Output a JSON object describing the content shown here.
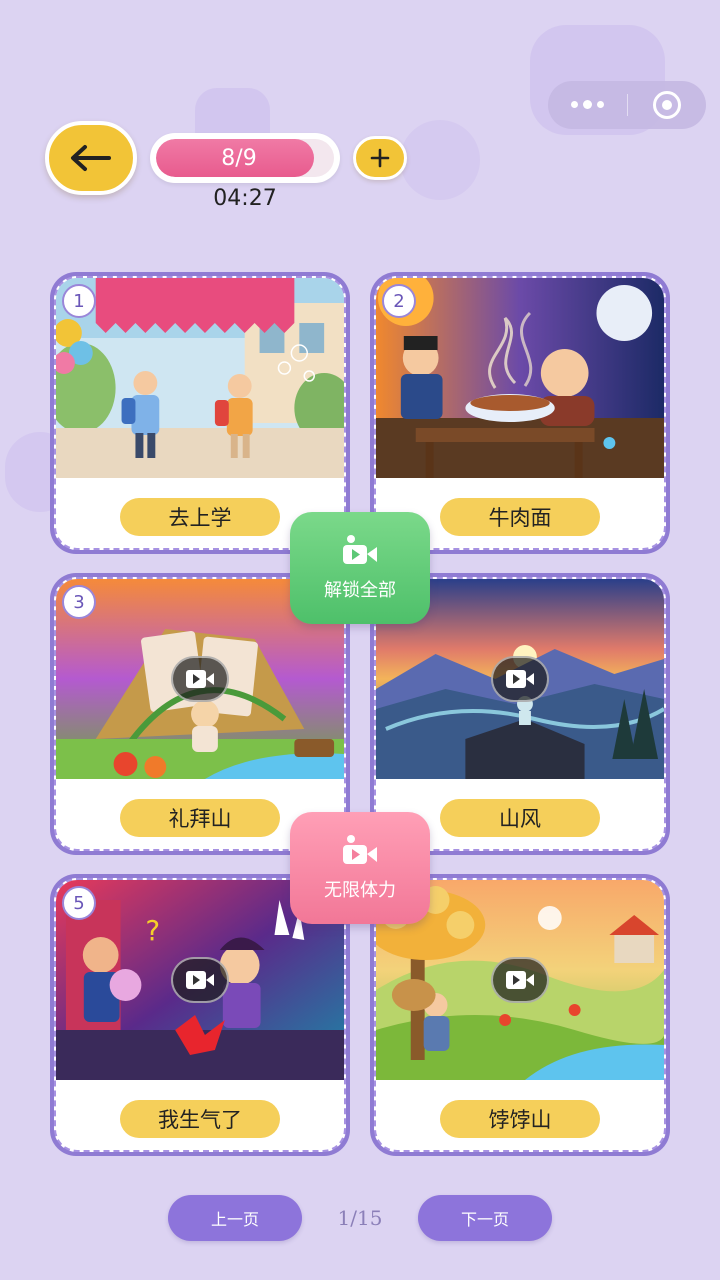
{
  "header": {
    "progress_text": "8/9",
    "progress_fraction": 0.889,
    "timer": "04:27",
    "back_icon": "arrow-left-icon",
    "plus_icon": "plus-icon"
  },
  "capsule": {
    "more_icon": "more-dots-icon",
    "close_icon": "target-icon"
  },
  "cards": [
    {
      "num": "1",
      "label": "去上学"
    },
    {
      "num": "2",
      "label": "牛肉面"
    },
    {
      "num": "3",
      "label": "礼拜山"
    },
    {
      "num": "",
      "label": "山风"
    },
    {
      "num": "5",
      "label": "我生气了"
    },
    {
      "num": "",
      "label": "饽饽山"
    }
  ],
  "tiles": {
    "unlock_label": "解锁全部",
    "stamina_label": "无限体力"
  },
  "pager": {
    "prev_label": "上一页",
    "page_text": "1/15",
    "next_label": "下一页"
  },
  "colors": {
    "background": "#dcd3f2",
    "accent_yellow": "#f2c437",
    "progress_pink": "#e85b8e",
    "card_border": "#8f7bd3",
    "unlock_green": "#4ec06a",
    "stamina_pink": "#f27797",
    "pager_purple": "#8d74db"
  }
}
